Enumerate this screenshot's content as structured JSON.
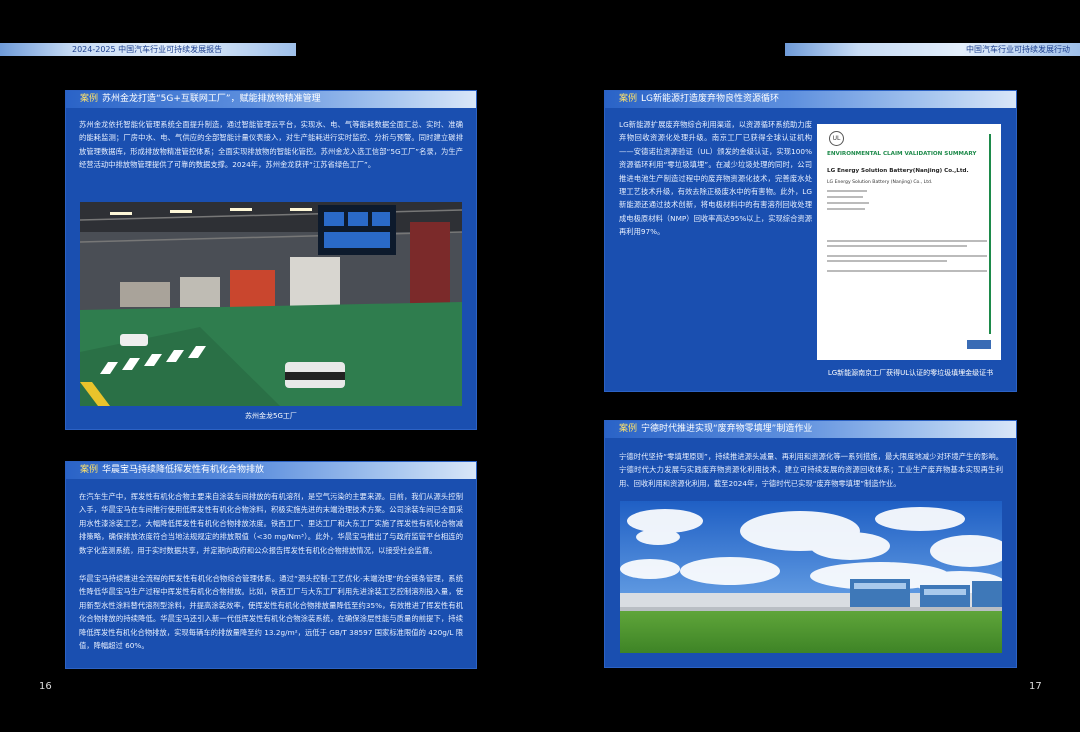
{
  "header": {
    "left_title": "2024-2025 中国汽车行业可持续发展报告",
    "right_title": "中国汽车行业可持续发展行动"
  },
  "panels": {
    "p1": {
      "tag": "案例",
      "title": "苏州金龙打造“5G+互联网工厂”，赋能排放物精准管理",
      "text": "苏州金龙依托智能化管理系统全面提升制造，通过智能管理云平台，实现水、电、气等能耗数据全面汇总、实时、准确的能耗监测；厂房中水、电、气供应的全部智能计量仪表接入，对生产能耗进行实时监控、分析与预警。同时建立碳排放管理数据库，形成排放物精准管控体系；全面实现排放物的智能化管控。苏州金龙入选工信部“5G工厂”名录，为生产经营活动中排放物管理提供了可靠的数据支撑。2024年，苏州金龙获评“江苏省绿色工厂”。",
      "caption": "苏州金龙5G工厂"
    },
    "p2": {
      "tag": "案例",
      "title": "LG新能源打造废弃物良性资源循环",
      "text": "LG新能源扩展废弃物综合利用渠道，以资源循环系统助力废弃物回收资源化处理升级。南京工厂已获得全球认证机构——安德诺拉资源验证（UL）颁发的金级认证，实现100%资源循环利用“零垃圾填埋”。在减少垃圾处理的同时，公司推进电池生产制造过程中的废弃物资源化技术，完善废水处理工艺技术升级，有效去除正极废水中的有害物。此外，LG新能源还通过技术创新，将电极材料中的有害溶剂回收处理成电极原材料（NMP）回收率高达95%以上，实现综合资源再利用97%。",
      "doc": {
        "heading": "ENVIRONMENTAL CLAIM VALIDATION SUMMARY",
        "company": "LG Energy Solution Battery(Nanjing) Co.,Ltd.",
        "sub": "LG Energy Solution Battery (Nanjing) Co., Ltd."
      },
      "caption": "LG新能源南京工厂获得UL认证的零垃圾填埋金级证书"
    },
    "p3": {
      "tag": "案例",
      "title": "华晨宝马持续降低挥发性有机化合物排放",
      "text1": "在汽车生产中，挥发性有机化合物主要来自涂装车间排放的有机溶剂，是空气污染的主要来源。目前，我们从源头控制入手，华晨宝马在车间推行使用低挥发性有机化合物涂料，积极实施先进的末端治理技术方案。公司涂装车间已全面采用水性漆涂装工艺，大幅降低挥发性有机化合物排放浓度。铁西工厂、里达工厂和大东工厂实施了挥发性有机化合物减排策略，确保排放浓度符合当地法规规定的排放限值（<30 mg/Nm³）。此外，华晨宝马推出了与政府监管平台相连的数字化监测系统，用于实时数据共享，并定期向政府和公众报告挥发性有机化合物排放情况，以接受社会监督。",
      "text2": "华晨宝马持续推进全流程的挥发性有机化合物综合管理体系。通过“源头控制-工艺优化-末端治理”的全链条管理，系统性降低华晨宝马生产过程中挥发性有机化合物排放。比如，铁西工厂与大东工厂利用先进涂装工艺控制溶剂投入量，使用新型水性涂料替代溶剂型涂料，并提高涂装效率，使挥发性有机化合物排放量降低至约35%，有效推进了挥发性有机化合物排放的持续降低。华晨宝马还引入新一代低挥发性有机化合物涂装系统，在确保涂层性能与质量的前提下，持续降低挥发性有机化合物排放，实现每辆车的排放量降至约 13.2g/m²，远低于 GB/T 38597 国家标准限值的 420g/L 限值，降幅超过 60%。"
    },
    "p4": {
      "tag": "案例",
      "title": "宁德时代推进实现“废弃物零填埋”制造作业",
      "text": "宁德时代坚持“零填埋原则”，持续推进源头减量、再利用和资源化等一系列措施，最大限度地减少对环境产生的影响。宁德时代大力发展与实践废弃物资源化利用技术，建立可持续发展的资源回收体系；工业生产废弃物基本实现再生利用、回收利用和资源化利用，截至2024年，宁德时代已实现“废弃物零填埋”制造作业。"
    }
  },
  "page_numbers": {
    "left": "16",
    "right": "17"
  }
}
